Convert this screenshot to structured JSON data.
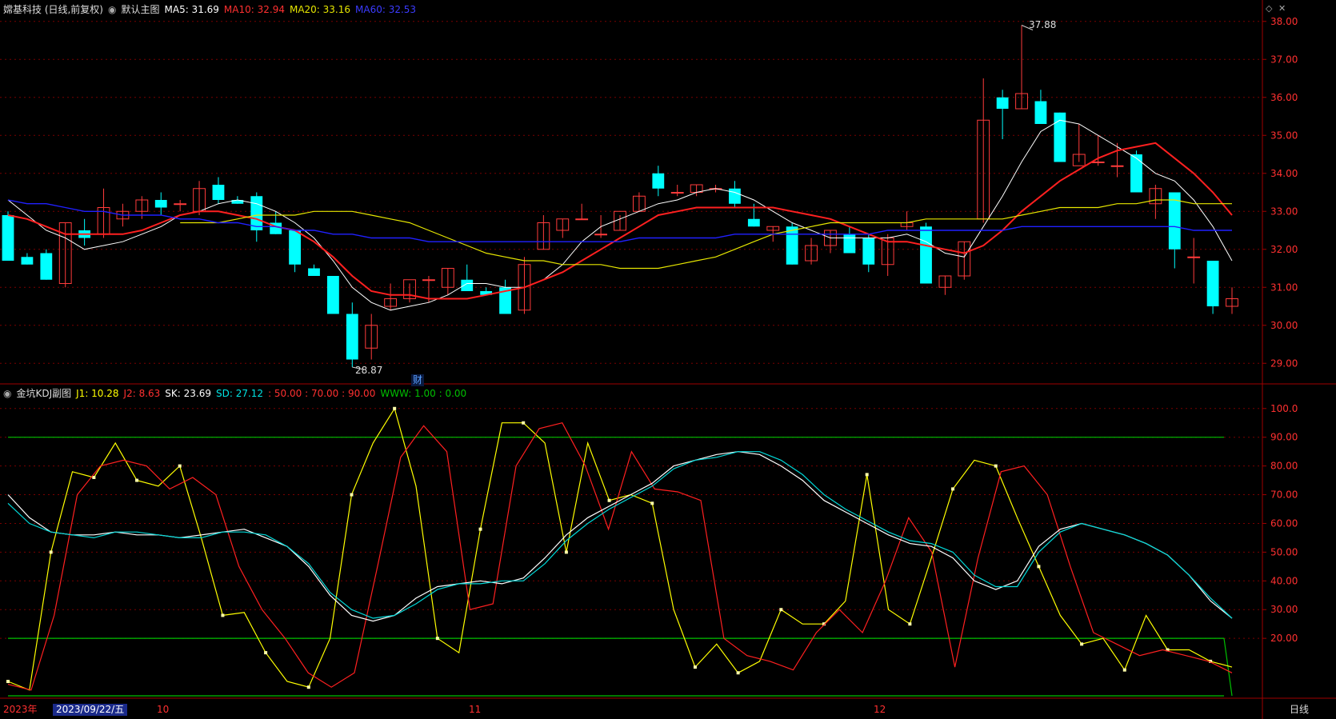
{
  "main_header": {
    "stock": "嫦基科技 (日线,前复权)",
    "view": "默认主图",
    "ma5": "MA5: 31.69",
    "ma10": "MA10: 32.94",
    "ma20": "MA20: 33.16",
    "ma60": "MA60: 32.53"
  },
  "sub_header": {
    "title": "金坑KDJ副图",
    "j1": "J1: 10.28",
    "j2": "J2: 8.63",
    "sk": "SK: 23.69",
    "sd": "SD: 27.12",
    "levels": ": 50.00 : 70.00 : 90.00",
    "www": "WWW: 1.00 : 0.00"
  },
  "annotations": {
    "high": "37.88",
    "low": "28.87",
    "fin_marker": "财"
  },
  "x_axis": {
    "year": "2023年",
    "cursor_date": "2023/09/22/五",
    "m10": "10",
    "m11": "11",
    "m12": "12",
    "period": "日线"
  },
  "colors": {
    "up": "#ff3b3b",
    "down": "#00ffff",
    "ma5": "#ffffff",
    "ma10": "#ff2020",
    "ma20": "#e6e600",
    "ma60": "#2020ff",
    "grid": "#7a0000"
  },
  "chart_data": [
    {
      "type": "candlestick",
      "title": "嫦基科技 (日线,前复权)",
      "ylim": [
        28.5,
        38.1
      ],
      "yticks": [
        "38.00",
        "37.00",
        "36.00",
        "35.00",
        "34.00",
        "33.00",
        "32.00",
        "31.00",
        "30.00",
        "29.00"
      ],
      "candles": [
        [
          32.9,
          33.0,
          31.7,
          31.7
        ],
        [
          31.8,
          31.9,
          31.6,
          31.6
        ],
        [
          31.9,
          32.0,
          31.2,
          31.2
        ],
        [
          31.1,
          32.7,
          31.0,
          32.7
        ],
        [
          32.5,
          32.8,
          32.1,
          32.3
        ],
        [
          32.4,
          33.6,
          32.3,
          33.1
        ],
        [
          32.8,
          33.2,
          32.6,
          33.0
        ],
        [
          33.0,
          33.4,
          32.8,
          33.3
        ],
        [
          33.3,
          33.5,
          32.9,
          33.1
        ],
        [
          33.2,
          33.3,
          33.0,
          33.2
        ],
        [
          33.0,
          33.8,
          32.9,
          33.6
        ],
        [
          33.7,
          33.9,
          33.2,
          33.3
        ],
        [
          33.3,
          33.4,
          33.2,
          33.2
        ],
        [
          33.4,
          33.5,
          32.2,
          32.5
        ],
        [
          32.7,
          33.0,
          32.4,
          32.4
        ],
        [
          32.5,
          32.5,
          31.4,
          31.6
        ],
        [
          31.5,
          31.6,
          31.3,
          31.3
        ],
        [
          31.3,
          31.3,
          30.3,
          30.3
        ],
        [
          30.3,
          30.6,
          28.9,
          29.1
        ],
        [
          29.4,
          30.3,
          29.1,
          30.0
        ],
        [
          30.5,
          31.1,
          30.4,
          30.7
        ],
        [
          30.7,
          31.1,
          30.6,
          31.2
        ],
        [
          31.2,
          31.3,
          30.6,
          31.2
        ],
        [
          31.0,
          31.5,
          30.8,
          31.5
        ],
        [
          31.2,
          31.6,
          30.9,
          30.9
        ],
        [
          30.9,
          31.0,
          30.8,
          30.8
        ],
        [
          31.0,
          31.2,
          30.3,
          30.3
        ],
        [
          30.4,
          31.8,
          30.3,
          31.6
        ],
        [
          32.0,
          32.9,
          32.0,
          32.7
        ],
        [
          32.5,
          32.8,
          32.3,
          32.8
        ],
        [
          32.8,
          33.2,
          32.8,
          32.8
        ],
        [
          32.4,
          32.9,
          32.3,
          32.4
        ],
        [
          32.5,
          32.9,
          32.5,
          33.0
        ],
        [
          33.0,
          33.5,
          33.0,
          33.4
        ],
        [
          34.0,
          34.2,
          33.4,
          33.6
        ],
        [
          33.5,
          33.7,
          33.4,
          33.5
        ],
        [
          33.5,
          33.7,
          33.4,
          33.7
        ],
        [
          33.6,
          33.7,
          33.5,
          33.6
        ],
        [
          33.6,
          33.8,
          33.1,
          33.2
        ],
        [
          32.8,
          33.2,
          32.6,
          32.6
        ],
        [
          32.5,
          32.6,
          32.2,
          32.6
        ],
        [
          32.6,
          32.7,
          31.6,
          31.6
        ],
        [
          31.7,
          32.3,
          31.6,
          32.1
        ],
        [
          32.1,
          32.5,
          31.9,
          32.5
        ],
        [
          32.4,
          32.6,
          31.9,
          31.9
        ],
        [
          32.3,
          32.4,
          31.4,
          31.6
        ],
        [
          31.6,
          32.4,
          31.3,
          32.3
        ],
        [
          32.6,
          33.0,
          32.5,
          32.7
        ],
        [
          32.6,
          32.7,
          31.1,
          31.1
        ],
        [
          31.0,
          31.3,
          30.8,
          31.3
        ],
        [
          31.3,
          32.2,
          31.2,
          32.2
        ],
        [
          32.8,
          36.5,
          32.7,
          35.4
        ],
        [
          36.0,
          36.2,
          34.9,
          35.7
        ],
        [
          35.7,
          37.9,
          35.7,
          36.1
        ],
        [
          35.9,
          36.2,
          35.3,
          35.3
        ],
        [
          35.6,
          35.6,
          34.3,
          34.3
        ],
        [
          34.2,
          35.3,
          34.3,
          34.5
        ],
        [
          34.3,
          35.0,
          34.2,
          34.3
        ],
        [
          34.2,
          34.8,
          33.9,
          34.2
        ],
        [
          34.5,
          34.6,
          33.5,
          33.5
        ],
        [
          33.2,
          33.7,
          32.8,
          33.6
        ],
        [
          33.5,
          33.5,
          31.5,
          32.0
        ],
        [
          31.8,
          32.3,
          31.1,
          31.8
        ],
        [
          31.7,
          31.7,
          30.3,
          30.5
        ],
        [
          30.5,
          31.0,
          30.3,
          30.7
        ]
      ],
      "series": [
        {
          "name": "MA5",
          "values": [
            33.3,
            32.9,
            32.5,
            32.3,
            32.0,
            32.1,
            32.2,
            32.4,
            32.6,
            32.9,
            33.0,
            33.2,
            33.3,
            33.2,
            33.0,
            32.7,
            32.3,
            31.7,
            31.0,
            30.6,
            30.4,
            30.5,
            30.6,
            30.8,
            31.1,
            31.1,
            31.0,
            31.0,
            31.2,
            31.6,
            32.2,
            32.6,
            32.8,
            33.0,
            33.2,
            33.3,
            33.5,
            33.6,
            33.5,
            33.3,
            33.0,
            32.7,
            32.5,
            32.3,
            32.3,
            32.3,
            32.3,
            32.4,
            32.2,
            31.9,
            31.8,
            32.6,
            33.4,
            34.3,
            35.1,
            35.4,
            35.3,
            35.0,
            34.7,
            34.4,
            34.0,
            33.8,
            33.3,
            32.6,
            31.7
          ]
        },
        {
          "name": "MA10",
          "values": [
            32.9,
            32.8,
            32.6,
            32.4,
            32.4,
            32.4,
            32.4,
            32.5,
            32.7,
            32.9,
            33.0,
            33.0,
            32.9,
            32.8,
            32.6,
            32.5,
            32.2,
            31.8,
            31.3,
            30.9,
            30.8,
            30.8,
            30.7,
            30.7,
            30.7,
            30.8,
            30.9,
            31.0,
            31.2,
            31.4,
            31.7,
            32.0,
            32.3,
            32.6,
            32.9,
            33.0,
            33.1,
            33.1,
            33.1,
            33.1,
            33.1,
            33.0,
            32.9,
            32.8,
            32.6,
            32.4,
            32.2,
            32.2,
            32.1,
            32.0,
            31.9,
            32.1,
            32.5,
            33.0,
            33.4,
            33.8,
            34.1,
            34.4,
            34.6,
            34.7,
            34.8,
            34.4,
            34.0,
            33.5,
            32.9
          ]
        },
        {
          "name": "MA20",
          "values": [
            32.7,
            32.7,
            32.7,
            32.8,
            32.9,
            32.9,
            32.9,
            33.0,
            33.0,
            33.0,
            32.9,
            32.8,
            32.7,
            32.5,
            32.3,
            32.1,
            31.9,
            31.8,
            31.7,
            31.7,
            31.6,
            31.6,
            31.6,
            31.5,
            31.5,
            31.5,
            31.6,
            31.7,
            31.8,
            32.0,
            32.2,
            32.4,
            32.5,
            32.6,
            32.7,
            32.7,
            32.7,
            32.7,
            32.7,
            32.8,
            32.8,
            32.8,
            32.8,
            32.8,
            32.9,
            33.0,
            33.1,
            33.1,
            33.1,
            33.2,
            33.2,
            33.3,
            33.3,
            33.2,
            33.2,
            33.2
          ]
        },
        {
          "name": "MA60",
          "values": [
            33.3,
            33.2,
            33.2,
            33.1,
            33.0,
            33.0,
            32.9,
            32.9,
            32.9,
            32.8,
            32.8,
            32.7,
            32.7,
            32.6,
            32.6,
            32.5,
            32.5,
            32.4,
            32.4,
            32.3,
            32.3,
            32.3,
            32.2,
            32.2,
            32.2,
            32.2,
            32.2,
            32.2,
            32.2,
            32.2,
            32.2,
            32.2,
            32.2,
            32.3,
            32.3,
            32.3,
            32.3,
            32.3,
            32.4,
            32.4,
            32.4,
            32.4,
            32.4,
            32.4,
            32.4,
            32.4,
            32.5,
            32.5,
            32.5,
            32.5,
            32.5,
            32.5,
            32.5,
            32.6,
            32.6,
            32.6,
            32.6,
            32.6,
            32.6,
            32.6,
            32.6,
            32.6,
            32.5,
            32.5,
            32.5
          ]
        }
      ]
    },
    {
      "type": "line",
      "title": "金坑KDJ副图",
      "ylim": [
        0,
        103
      ],
      "yticks": [
        "100.0",
        "90.00",
        "80.00",
        "70.00",
        "60.00",
        "50.00",
        "40.00",
        "30.00",
        "20.00"
      ],
      "hlines": [
        90,
        20,
        0
      ],
      "series": [
        {
          "name": "J1",
          "values": [
            5,
            2,
            50,
            78,
            76,
            88,
            75,
            73,
            80,
            55,
            28,
            29,
            15,
            5,
            3,
            20,
            70,
            88,
            100,
            73,
            20,
            15,
            58,
            95,
            95,
            88,
            50,
            88,
            68,
            70,
            67,
            30,
            10,
            18,
            8,
            12,
            30,
            25,
            25,
            33,
            77,
            30,
            25,
            48,
            72,
            82,
            80,
            62,
            45,
            28,
            18,
            20,
            9,
            28,
            16,
            16,
            12,
            10
          ]
        },
        {
          "name": "J2",
          "values": [
            4,
            2,
            28,
            70,
            80,
            82,
            80,
            72,
            76,
            70,
            45,
            30,
            20,
            8,
            3,
            8,
            45,
            83,
            94,
            85,
            30,
            32,
            80,
            93,
            95,
            80,
            58,
            85,
            72,
            71,
            68,
            20,
            14,
            12,
            9,
            22,
            30,
            22,
            40,
            62,
            50,
            10,
            48,
            78,
            80,
            70,
            45,
            22,
            18,
            14,
            16,
            14,
            12,
            8
          ]
        },
        {
          "name": "SK",
          "values": [
            70,
            62,
            57,
            56,
            56,
            57,
            56,
            56,
            55,
            56,
            57,
            58,
            55,
            52,
            45,
            35,
            28,
            26,
            28,
            34,
            38,
            39,
            40,
            39,
            41,
            48,
            56,
            62,
            66,
            70,
            74,
            80,
            82,
            84,
            85,
            84,
            80,
            75,
            68,
            64,
            60,
            56,
            53,
            52,
            48,
            40,
            37,
            40,
            52,
            58,
            60,
            58,
            56,
            53,
            49,
            42,
            33,
            27
          ]
        },
        {
          "name": "SD",
          "values": [
            67,
            60,
            57,
            56,
            55,
            57,
            57,
            56,
            55,
            55,
            57,
            57,
            56,
            52,
            46,
            36,
            30,
            27,
            28,
            32,
            37,
            39,
            39,
            40,
            40,
            46,
            54,
            60,
            65,
            69,
            73,
            79,
            82,
            83,
            85,
            85,
            82,
            77,
            70,
            65,
            61,
            57,
            54,
            53,
            50,
            42,
            38,
            38,
            50,
            57,
            60,
            58,
            56,
            53,
            49,
            42,
            34,
            27
          ]
        }
      ]
    }
  ]
}
